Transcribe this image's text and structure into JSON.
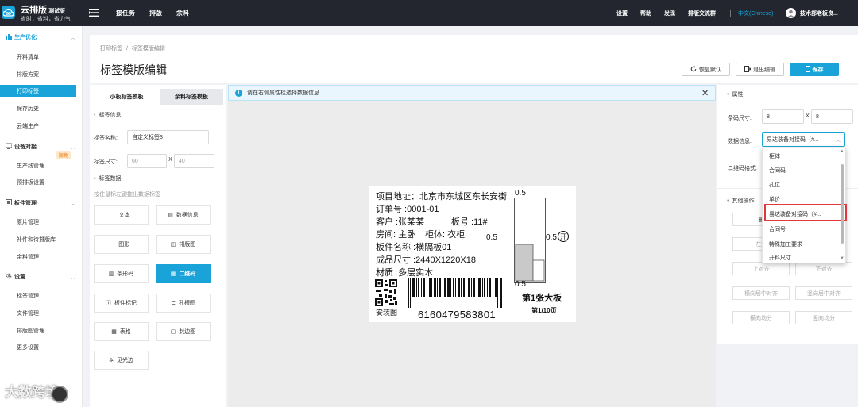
{
  "app": {
    "name": "云排版",
    "edition": "测试版",
    "slogan": "省时，省料，省力气"
  },
  "topnav": {
    "items": [
      "接任务",
      "排版",
      "余料"
    ]
  },
  "topright": {
    "settings": "设置",
    "help": "帮助",
    "discover": "发现",
    "community": "排版交流群",
    "language": "中文(Chinese)",
    "user": "技术部老板良..."
  },
  "sidebar": {
    "groups": [
      {
        "label": "生产优化",
        "items": [
          "开料清单",
          "排版方案",
          "打印标签",
          "保存历史",
          "云端生产"
        ]
      },
      {
        "label": "设备对接",
        "items": [
          "生产线管理",
          "预排板设置"
        ]
      },
      {
        "label": "板件管理",
        "items": [
          "原片管理",
          "补件和待排版库",
          "余料管理"
        ]
      },
      {
        "label": "设置",
        "items": [
          "标签管理",
          "文件管理",
          "排版图管理",
          "更多设置"
        ]
      }
    ],
    "active": "打印标签",
    "badge": "限免"
  },
  "watermark": "大数跨境",
  "header": {
    "breadcrumb_root": "打印标签",
    "breadcrumb_sep": "/",
    "breadcrumb_current": "标签模版编辑",
    "title": "标签模版编辑",
    "btn_restore": "恢复默认",
    "btn_exit": "退出编辑",
    "btn_save": "保存"
  },
  "left": {
    "tab_small": "小板标签模板",
    "tab_leftover": "余料标签模板",
    "sec_info": "标签信息",
    "name_label": "标签名称:",
    "name_value": "自定义标签3",
    "size_label": "标签尺寸:",
    "size_w": "60",
    "size_x": "X",
    "size_h": "40",
    "sec_data": "标签数据",
    "hint": "按住鼠标左键拖出数据标签",
    "tools": [
      "文本",
      "数据信息",
      "图形",
      "排版图",
      "条形码",
      "二维码",
      "板件标记",
      "孔槽图",
      "表格",
      "封边图",
      "见光边"
    ]
  },
  "canvas": {
    "info": "请在右侧属性栏选择数据信息",
    "label": {
      "address": "项目地址：北京市东城区东长安街",
      "order": "订单号 :0001-01",
      "customer": "客户 :张某某",
      "board_no": "板号 :11#",
      "room": "房间: 主卧",
      "cabinet": "柜体: 衣柜",
      "part_name": "板件名称 :横隔板01",
      "size": "成品尺寸 :2440X1220X18",
      "material": "材质 :多层实木",
      "install": "安装图",
      "barcode_num": "6160479583801",
      "board_title": "第1张大板",
      "page": "第1/10页",
      "dim_top": "0.5",
      "dim_left": "0.5",
      "dim_right": "0.5",
      "dim_bottom": "0.5",
      "open_mark": "开"
    }
  },
  "right": {
    "sec_prop": "属性",
    "code_size_label": "条码尺寸:",
    "code_w": "8",
    "code_x": "X",
    "code_h": "8",
    "data_info_label": "数据信息:",
    "data_info_value": "易达装备对接码（#...",
    "qr_format_label": "二维码格式:",
    "sec_other": "其他操作",
    "buttons": [
      "删",
      "左对",
      "上对齐",
      "下对齐",
      "横向居中对齐",
      "竖向居中对齐",
      "横向均分",
      "竖向均分"
    ]
  },
  "dropdown": {
    "options": [
      "柜体",
      "合同码",
      "孔位",
      "单价",
      "易达装备对接码（#...",
      "合同号",
      "特殊加工要求",
      "开料尺寸"
    ],
    "selected": "易达装备对接码（#..."
  },
  "colors": {
    "accent": "#1aa3d9",
    "topbar": "#23262e",
    "highlight": "#e0383e",
    "warn": "#e87c1e"
  }
}
